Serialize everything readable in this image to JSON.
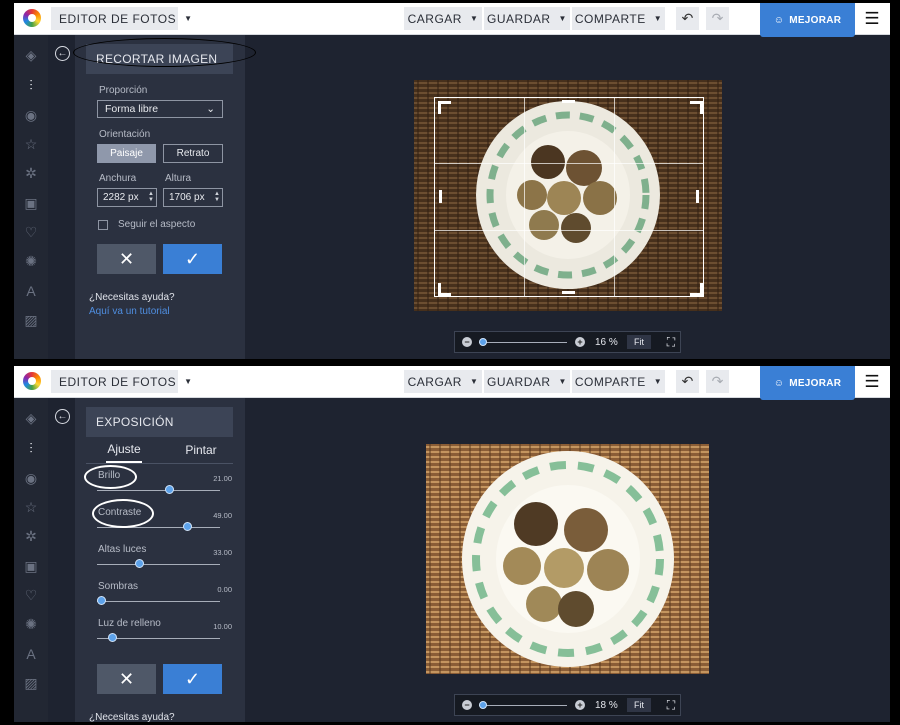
{
  "toolbar": {
    "app_menu": "EDITOR DE FOTOS",
    "cargar": "CARGAR",
    "guardar": "GUARDAR",
    "comparte": "COMPARTE",
    "mejorar": "MEJORAR"
  },
  "icons": {
    "undo": "↶",
    "redo": "↷",
    "menu": "☰",
    "caret": "▼",
    "check": "✓",
    "close": "✕",
    "back": "←",
    "rail": [
      "layers-icon",
      "sliders-icon",
      "eye-icon",
      "star-icon",
      "gear-icon",
      "frame-icon",
      "heart-icon",
      "badge-icon",
      "text-icon",
      "texture-icon"
    ]
  },
  "crop_panel": {
    "title": "RECORTAR IMAGEN",
    "proportion_label": "Proporción",
    "proportion_value": "Forma libre",
    "orientation_label": "Orientación",
    "landscape": "Paisaje",
    "portrait": "Retrato",
    "width_label": "Anchura",
    "height_label": "Altura",
    "width_value": "2282 px",
    "height_value": "1706 px",
    "keep_aspect": "Seguir el aspecto",
    "help": "¿Necesitas ayuda?",
    "tutorial": "Aquí va un tutorial",
    "zoom": "16 %",
    "fit": "Fit"
  },
  "exposure_panel": {
    "title": "EXPOSICIÓN",
    "tabs": [
      "Ajuste",
      "Pintar"
    ],
    "sliders": [
      {
        "label": "Brillo",
        "value": "21.00",
        "level": 0.6
      },
      {
        "label": "Contraste",
        "value": "49.00",
        "level": 0.75
      },
      {
        "label": "Altas luces",
        "value": "33.00",
        "level": 0.33
      },
      {
        "label": "Sombras",
        "value": "0.00",
        "level": 0.0
      },
      {
        "label": "Luz de relleno",
        "value": "10.00",
        "level": 0.1
      }
    ],
    "help": "¿Necesitas ayuda?",
    "zoom": "18 %",
    "fit": "Fit"
  },
  "colors": {
    "accent": "#3a7fd5",
    "panel": "#2b3140",
    "canvas": "#1e2330"
  }
}
